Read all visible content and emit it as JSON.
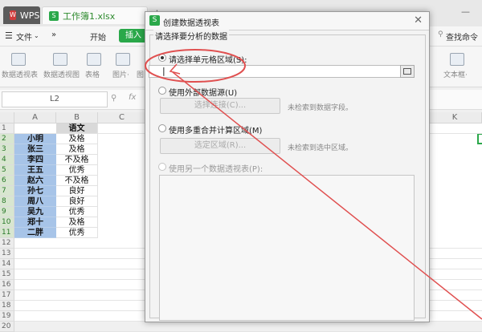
{
  "titlebar": {
    "wps_tab": "WPS",
    "workbook_tab": "工作簿1.xlsx",
    "new_tab_symbol": "+",
    "minimize_symbol": "—"
  },
  "menubar": {
    "file": "文件",
    "start": "开始",
    "insert": "插入",
    "search_label": "查找命令"
  },
  "toolbar": {
    "items": [
      "数据透视表",
      "数据透视图",
      "表格",
      "图片·",
      "图",
      "文本框·"
    ]
  },
  "formula_bar": {
    "cell_ref": "L2",
    "fx": "fx"
  },
  "sheet": {
    "columns": [
      "A",
      "B",
      "C",
      "K"
    ],
    "rows": [
      "1",
      "2",
      "3",
      "4",
      "5",
      "6",
      "7",
      "8",
      "9",
      "10",
      "11",
      "12",
      "13",
      "14",
      "15",
      "16",
      "17",
      "18",
      "19",
      "20"
    ],
    "header_b1": "语文",
    "names": [
      "小明",
      "张三",
      "李四",
      "王五",
      "赵六",
      "孙七",
      "周八",
      "吴九",
      "郑十",
      "二胖"
    ],
    "grades": [
      "及格",
      "及格",
      "不及格",
      "优秀",
      "不及格",
      "良好",
      "良好",
      "优秀",
      "及格",
      "优秀"
    ]
  },
  "dialog": {
    "title": "创建数据透视表",
    "group_title": "请选择要分析的数据",
    "opt_range": "请选择单元格区域(S):",
    "opt_external": "使用外部数据源(U)",
    "btn_select_connection": "选择连接(C)...",
    "note_no_fields": "未检索到数据字段。",
    "opt_multi": "使用多重合并计算区域(M)",
    "btn_select_region": "选定区域(R)...",
    "note_no_region": "未检索到选中区域。",
    "opt_another_pivot": "使用另一个数据透视表(P):",
    "range_value": "|"
  },
  "annotation": {
    "color": "#e05050"
  }
}
